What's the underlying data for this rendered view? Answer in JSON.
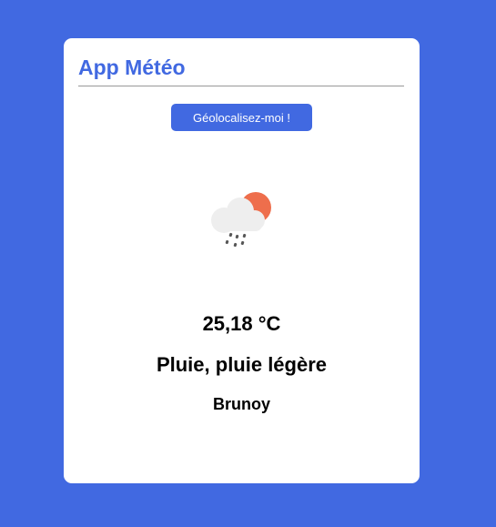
{
  "app": {
    "title": "App Météo"
  },
  "geolocate_button": {
    "label": "Géolocalisez-moi !"
  },
  "weather": {
    "icon": "sun-cloud-rain-icon",
    "temperature": "25,18 °C",
    "description": "Pluie, pluie légère",
    "city": "Brunoy"
  },
  "colors": {
    "background": "#4169e1",
    "card": "#ffffff",
    "accent": "#4169e1",
    "sun": "#ee6e4c",
    "cloud": "#eeeeee",
    "rain": "#555555"
  }
}
